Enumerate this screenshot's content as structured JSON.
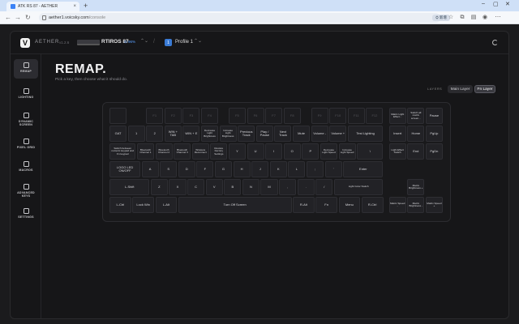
{
  "browser": {
    "tab_title": "ATK RS 87 - AETHER",
    "url_host": "aether1.voicsky.com",
    "url_path": "/console",
    "chip": "⛭ 新增"
  },
  "app": {
    "brand": "AETHER",
    "version": "v1.2.6",
    "device_name": "RTIROS 87",
    "device_tag": "⊙ 96%",
    "profile_badge": "1",
    "profile_name": "Profile 1",
    "page_title": "REMAP.",
    "page_subtitle": "Pick a key, then choose what it should do.",
    "layers_label": "LAYERS",
    "layer_main": "Main Layer",
    "layer_fn": "Fn Layer"
  },
  "sidebar": [
    {
      "label": "REMAP",
      "icon": "keyboard-icon",
      "active": true
    },
    {
      "label": "LIGHTING",
      "icon": "bulb-icon",
      "active": false
    },
    {
      "label": "DYNAMIC\nSCREEN",
      "icon": "monitor-icon",
      "active": false
    },
    {
      "label": "PIXEL GRID",
      "icon": "grid-icon",
      "active": false
    },
    {
      "label": "MACROS",
      "icon": "macro-icon",
      "active": false
    },
    {
      "label": "ADVANCED\nKEYS",
      "icon": "advanced-keys-icon",
      "active": false
    },
    {
      "label": "SETTINGS",
      "icon": "gear-icon",
      "active": false
    }
  ],
  "keys": [
    {
      "label": "",
      "dim": true
    },
    {
      "label": "F1",
      "dim": true
    },
    {
      "label": "F2",
      "dim": true
    },
    {
      "label": "F3",
      "dim": true
    },
    {
      "label": "F4",
      "dim": true
    },
    {
      "label": "F5",
      "dim": true
    },
    {
      "label": "F6",
      "dim": true
    },
    {
      "label": "F7",
      "dim": true
    },
    {
      "label": "F8",
      "dim": true
    },
    {
      "label": "F9",
      "dim": true
    },
    {
      "label": "F10",
      "dim": true
    },
    {
      "label": "F11",
      "dim": true
    },
    {
      "label": "F12",
      "dim": true
    },
    {
      "label": "Matrix Light Effect...",
      "sm": true
    },
    {
      "label": "Switch all matrix screen...",
      "sm": true
    },
    {
      "label": "Pause"
    },
    {
      "label": "GAT"
    },
    {
      "label": "1"
    },
    {
      "label": "2"
    },
    {
      "label": "WIN + TAB"
    },
    {
      "label": "WIN + E"
    },
    {
      "label": "Decrease Light Brightness",
      "sm": true
    },
    {
      "label": "Increase Light Brightness",
      "sm": true
    },
    {
      "label": "Previous Track"
    },
    {
      "label": "Play / Pause"
    },
    {
      "label": "Next Track"
    },
    {
      "label": "Mute"
    },
    {
      "label": "Volume -"
    },
    {
      "label": "Volume +"
    },
    {
      "label": "Test Lighting"
    },
    {
      "label": "Insert"
    },
    {
      "label": "Home"
    },
    {
      "label": "PgUp"
    },
    {
      "label": "Switch between numeric keypad and Fn keypad",
      "sm": true
    },
    {
      "label": "Bluetooth Channel 1",
      "sm": true
    },
    {
      "label": "Bluetooth Channel 2",
      "sm": true
    },
    {
      "label": "Bluetooth Channel 3",
      "sm": true
    },
    {
      "label": "Wireless Reconnect",
      "sm": true
    },
    {
      "label": "Restore Factory Settings",
      "sm": true
    },
    {
      "label": "Y"
    },
    {
      "label": "U"
    },
    {
      "label": "I"
    },
    {
      "label": "O"
    },
    {
      "label": "P"
    },
    {
      "label": "Decrease Light Speed",
      "sm": true
    },
    {
      "label": "Increase Light Speed",
      "sm": true
    },
    {
      "label": "\\"
    },
    {
      "label": "Light Effect Switch",
      "sm": true
    },
    {
      "label": "End"
    },
    {
      "label": "PgDn"
    },
    {
      "label": "LOGO LED ON/OFF"
    },
    {
      "label": "A"
    },
    {
      "label": "S"
    },
    {
      "label": "D"
    },
    {
      "label": "F"
    },
    {
      "label": "G"
    },
    {
      "label": "H"
    },
    {
      "label": "J"
    },
    {
      "label": "K"
    },
    {
      "label": "L"
    },
    {
      "label": ";"
    },
    {
      "label": "'"
    },
    {
      "label": "Enter"
    },
    {
      "label": "L-Shift"
    },
    {
      "label": "Z"
    },
    {
      "label": "X"
    },
    {
      "label": "C"
    },
    {
      "label": "V"
    },
    {
      "label": "B"
    },
    {
      "label": "N"
    },
    {
      "label": "M"
    },
    {
      "label": ","
    },
    {
      "label": "."
    },
    {
      "label": "/"
    },
    {
      "label": "Light Color Switch",
      "sm": true
    },
    {
      "label": "Matrix Brightness +",
      "sm": true
    },
    {
      "label": "L-Ctrl"
    },
    {
      "label": "Lock Win"
    },
    {
      "label": "L-Alt"
    },
    {
      "label": "Turn Off Screen"
    },
    {
      "label": "R-Alt"
    },
    {
      "label": "Fn"
    },
    {
      "label": "Menu"
    },
    {
      "label": "R-Ctrl"
    },
    {
      "label": "Matrix Speed -",
      "sm": true
    },
    {
      "label": "Matrix Brightness -",
      "sm": true
    },
    {
      "label": "Matrix Speed +",
      "sm": true
    }
  ]
}
